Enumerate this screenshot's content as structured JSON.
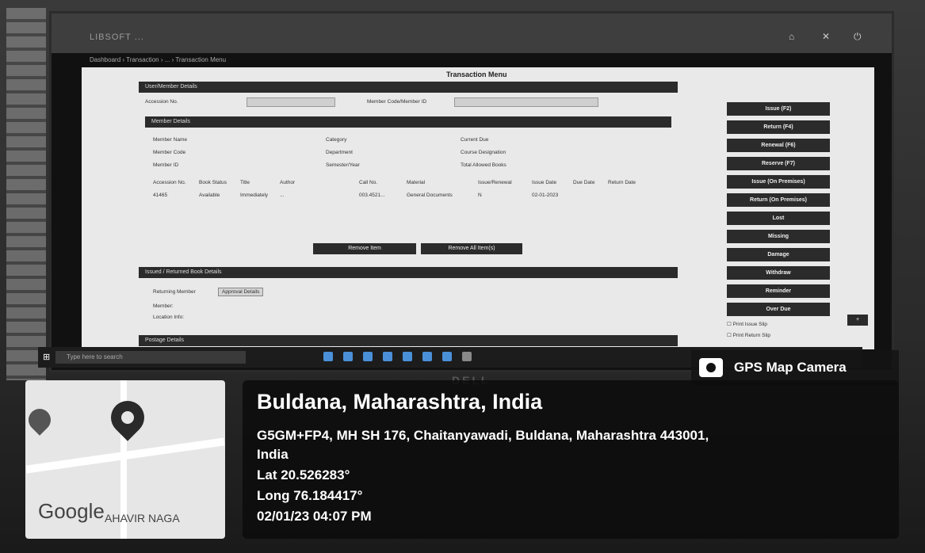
{
  "screen": {
    "title": "Transaction Menu",
    "brand": "LIBSOFT ...",
    "breadcrumb": "Dashboard › Transaction › ... › Transaction Menu",
    "sections": {
      "user_member_details": "User/Member Details",
      "member_details": "Member Details",
      "issued_returned": "Issued / Returned Book Details",
      "postage_details": "Postage Details"
    },
    "labels": {
      "accession_no": "Accession No.",
      "member_code": "Member Code/Member ID",
      "member_name": "Member Name",
      "category": "Category",
      "current_due": "Current Due",
      "member_code2": "Member Code",
      "department": "Department",
      "course_designation": "Course Designation",
      "member_id": "Member ID",
      "semester": "Semester/Year",
      "total_allowed": "Total Allowed Books"
    },
    "table_headers": [
      "Accession No.",
      "Book Status",
      "Title",
      "Author",
      "Call No.",
      "Material",
      "Issue/Renewal",
      "Issue Date",
      "Due Date",
      "Return Date"
    ],
    "table_row": [
      "41465",
      "Available",
      "Immediately",
      "...",
      "003.4521...",
      "General Documents",
      "N",
      "02-01-2023",
      "",
      ""
    ],
    "buttons": {
      "remove_item": "Remove Item",
      "remove_all": "Remove All Item(s)",
      "approval_details": "Approval Details"
    },
    "side_buttons": [
      "Issue (F2)",
      "Return (F4)",
      "Renewal (F6)",
      "Reserve (F7)",
      "Issue (On Premises)",
      "Return (On Premises)",
      "Lost",
      "Missing",
      "Damage",
      "Withdraw",
      "Reminder",
      "Over Due"
    ],
    "checkboxes": [
      "Print Issue Slip",
      "Print Return Slip"
    ],
    "lower_labels": [
      "Returning Member",
      "Member:",
      "Location Info:"
    ]
  },
  "taskbar": {
    "search_placeholder": "Type here to search"
  },
  "monitor_brand": "DELL",
  "gps": {
    "tag": "GPS Map Camera",
    "city": "Buldana, Maharashtra, India",
    "address_line1": "G5GM+FP4, MH SH 176, Chaitanyawadi, Buldana, Maharashtra 443001,",
    "address_line2": "India",
    "lat": "Lat 20.526283°",
    "long": "Long 76.184417°",
    "datetime": "02/01/23 04:07 PM"
  },
  "map": {
    "logo": "Google",
    "area": "AHAVIR NAGA"
  }
}
